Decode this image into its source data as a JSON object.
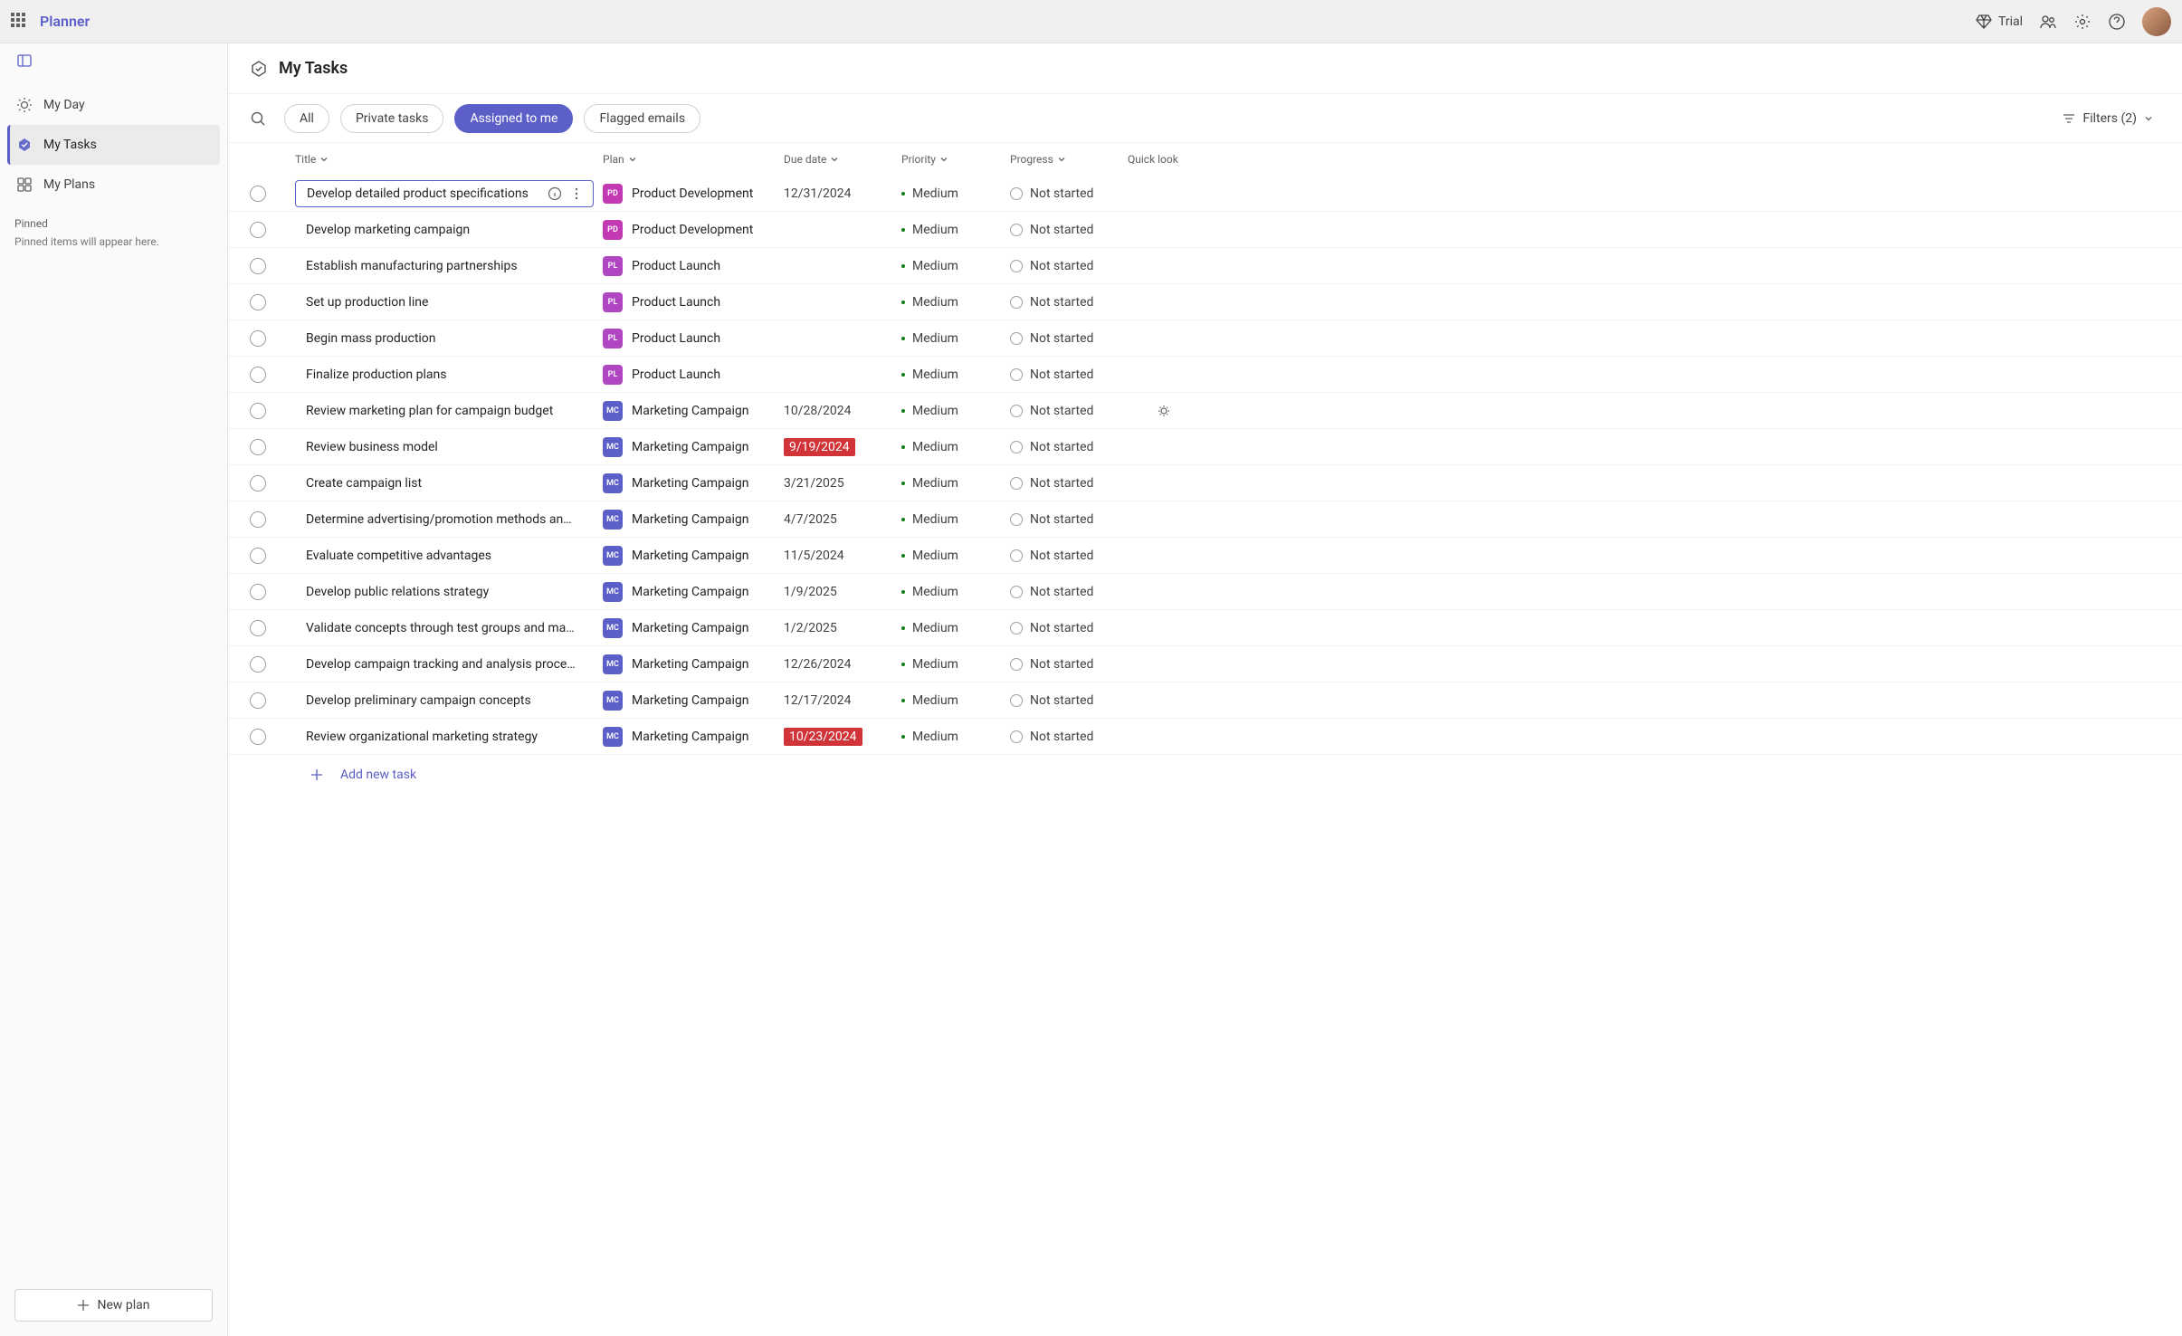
{
  "app_name": "Planner",
  "topbar": {
    "trial_label": "Trial"
  },
  "sidebar": {
    "items": [
      {
        "label": "My Day"
      },
      {
        "label": "My Tasks"
      },
      {
        "label": "My Plans"
      }
    ],
    "pinned_label": "Pinned",
    "pinned_empty": "Pinned items will appear here.",
    "new_plan": "New plan"
  },
  "header": {
    "title": "My Tasks"
  },
  "tabs": {
    "all": "All",
    "private": "Private tasks",
    "assigned": "Assigned to me",
    "flagged": "Flagged emails"
  },
  "filters": {
    "label": "Filters (2)"
  },
  "columns": {
    "title": "Title",
    "plan": "Plan",
    "due": "Due date",
    "priority": "Priority",
    "progress": "Progress",
    "quick": "Quick look"
  },
  "priority": "Medium",
  "progress": "Not started",
  "add_task": "Add new task",
  "tasks": [
    {
      "title": "Develop detailed product specifications",
      "plan": "Product Development",
      "badge": "PD",
      "due": "12/31/2024",
      "overdue": false,
      "quick": false,
      "selected": true
    },
    {
      "title": "Develop marketing campaign",
      "plan": "Product Development",
      "badge": "PD",
      "due": "",
      "overdue": false,
      "quick": false
    },
    {
      "title": "Establish manufacturing partnerships",
      "plan": "Product Launch",
      "badge": "PL",
      "due": "",
      "overdue": false,
      "quick": false
    },
    {
      "title": "Set up production line",
      "plan": "Product Launch",
      "badge": "PL",
      "due": "",
      "overdue": false,
      "quick": false
    },
    {
      "title": "Begin mass production",
      "plan": "Product Launch",
      "badge": "PL",
      "due": "",
      "overdue": false,
      "quick": false
    },
    {
      "title": "Finalize production plans",
      "plan": "Product Launch",
      "badge": "PL",
      "due": "",
      "overdue": false,
      "quick": false
    },
    {
      "title": "Review marketing plan for campaign budget",
      "plan": "Marketing Campaign",
      "badge": "MC",
      "due": "10/28/2024",
      "overdue": false,
      "quick": true
    },
    {
      "title": "Review business model",
      "plan": "Marketing Campaign",
      "badge": "MC",
      "due": "9/19/2024",
      "overdue": true,
      "quick": false
    },
    {
      "title": "Create campaign list",
      "plan": "Marketing Campaign",
      "badge": "MC",
      "due": "3/21/2025",
      "overdue": false,
      "quick": false
    },
    {
      "title": "Determine advertising/promotion methods and mix",
      "plan": "Marketing Campaign",
      "badge": "MC",
      "due": "4/7/2025",
      "overdue": false,
      "quick": false
    },
    {
      "title": "Evaluate competitive advantages",
      "plan": "Marketing Campaign",
      "badge": "MC",
      "due": "11/5/2024",
      "overdue": false,
      "quick": false
    },
    {
      "title": "Develop public relations strategy",
      "plan": "Marketing Campaign",
      "badge": "MC",
      "due": "1/9/2025",
      "overdue": false,
      "quick": false
    },
    {
      "title": "Validate concepts through test groups and market resea",
      "plan": "Marketing Campaign",
      "badge": "MC",
      "due": "1/2/2025",
      "overdue": false,
      "quick": false
    },
    {
      "title": "Develop campaign tracking and analysis process",
      "plan": "Marketing Campaign",
      "badge": "MC",
      "due": "12/26/2024",
      "overdue": false,
      "quick": false
    },
    {
      "title": "Develop preliminary campaign concepts",
      "plan": "Marketing Campaign",
      "badge": "MC",
      "due": "12/17/2024",
      "overdue": false,
      "quick": false
    },
    {
      "title": "Review organizational marketing strategy",
      "plan": "Marketing Campaign",
      "badge": "MC",
      "due": "10/23/2024",
      "overdue": true,
      "quick": false
    }
  ]
}
